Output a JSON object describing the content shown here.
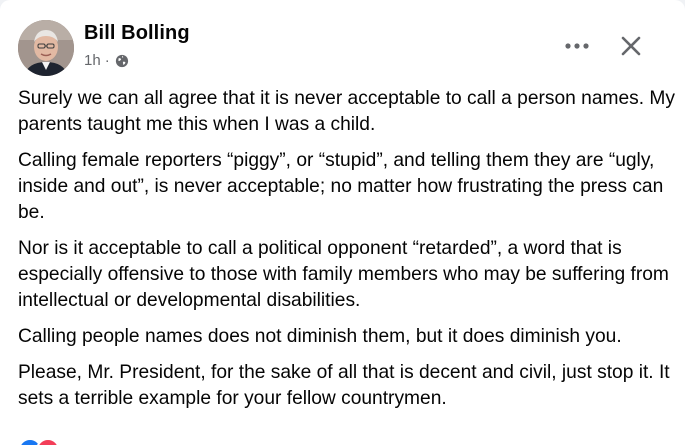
{
  "post": {
    "author": "Bill Bolling",
    "time": "1h",
    "separator": "·",
    "audience_icon": "globe-icon",
    "paragraphs": [
      "Surely we can all agree that it is never acceptable to call a person names. My parents taught me this when I was a child.",
      "Calling female reporters “piggy”, or “stupid”, and telling them they are “ugly, inside and out”, is never acceptable; no matter how frustrating the press can be.",
      "Nor is it acceptable to call a political opponent “retarded”, a word that is especially offensive to those with family members who may be suffering from intellectual or developmental disabilities.",
      "Calling people names does not diminish them, but it does diminish you.",
      "Please, Mr. President, for the sake of all that is decent and civil, just stop it. It sets a terrible example for your fellow countrymen."
    ]
  },
  "controls": {
    "more_icon": "more-horizontal-icon",
    "close_icon": "close-icon"
  },
  "colors": {
    "text_primary": "#050505",
    "text_secondary": "#65676b",
    "like_blue": "#1877f2",
    "love_red": "#f33e58"
  }
}
